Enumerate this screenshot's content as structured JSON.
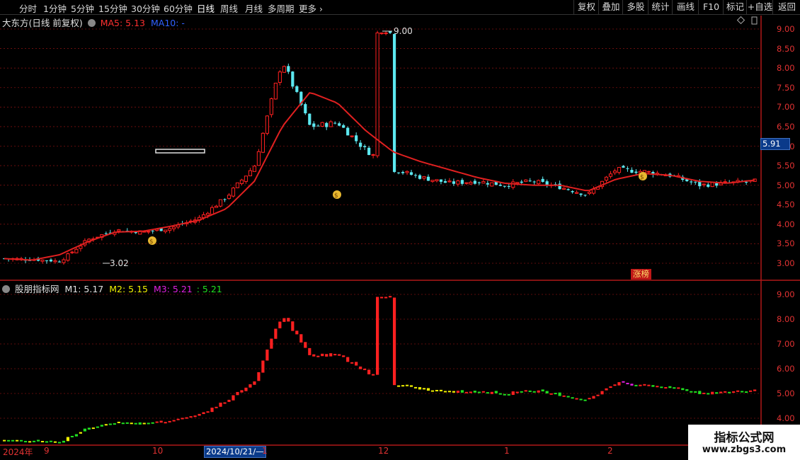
{
  "toolbar": {
    "periods": [
      "分时",
      "1分钟",
      "5分钟",
      "15分钟",
      "30分钟",
      "60分钟",
      "日线",
      "周线",
      "月线",
      "多周期",
      "更多"
    ],
    "active_period": "日线",
    "right_buttons": [
      "复权",
      "叠加",
      "多股",
      "统计",
      "画线",
      "F10",
      "标记",
      "+自选",
      "返回"
    ]
  },
  "main_panel": {
    "stock_title": "大东方(日线 前复权)",
    "ma5_label": "MA5: 5.13",
    "ma10_label": "MA10: -",
    "high_marker": "9.00",
    "low_marker": "3.02",
    "current_price": "5.91",
    "badge": "涨榜",
    "y_ticks": [
      "9.00",
      "8.50",
      "8.00",
      "7.50",
      "7.00",
      "6.50",
      "6.00",
      "5.50",
      "5.00",
      "4.50",
      "4.00",
      "3.50",
      "3.00"
    ],
    "colors": {
      "ma5": "#e02020",
      "ma10": "#2040ff",
      "up": "#ff2020",
      "down": "#5ce8f0"
    }
  },
  "sub_panel": {
    "indicator_name": "股朋指标网",
    "m1_label": "M1: 5.17",
    "m2_label": "M2: 5.15",
    "m3_label": "M3: 5.21",
    "m4_label": ": 5.21",
    "y_ticks": [
      "9.00",
      "8.00",
      "7.00",
      "6.00",
      "5.00",
      "4.00"
    ],
    "colors": {
      "m1": "#e0e0e0",
      "m2": "#f0f000",
      "m3": "#e020e0",
      "m4": "#20e020"
    }
  },
  "time_axis": {
    "labels": [
      "2024年",
      "9",
      "10",
      "1",
      "12",
      "1",
      "2"
    ],
    "cursor_date": "2024/10/21/—"
  },
  "watermark": {
    "title": "指标公式网",
    "url": "www.zbgs3.com"
  },
  "chart_data": {
    "type": "candlestick",
    "series": [
      {
        "name": "MA5",
        "values": [
          3.12,
          3.08,
          3.22,
          3.55,
          3.8,
          3.82,
          3.95,
          4.1,
          4.4,
          5.1,
          6.5,
          7.38,
          7.1,
          6.4,
          5.85,
          5.6,
          5.4,
          5.2,
          5.05,
          5.0,
          5.0,
          4.85,
          5.15,
          5.3,
          5.25,
          5.1,
          5.05,
          5.13
        ]
      }
    ],
    "close": [
      3.12,
      3.1,
      3.05,
      3.6,
      3.85,
      3.8,
      3.9,
      4.15,
      4.7,
      5.5,
      8.2,
      6.5,
      6.6,
      5.9,
      5.4,
      5.2,
      5.05,
      5.1,
      5.0,
      5.1,
      4.95,
      4.75,
      5.4,
      5.35,
      5.25,
      5.0,
      5.05,
      5.1
    ],
    "ylim": [
      2.75,
      9.25
    ],
    "period_high": 9.0,
    "period_low": 3.02
  }
}
